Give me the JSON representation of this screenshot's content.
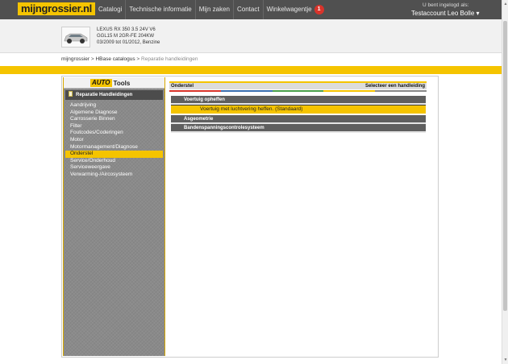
{
  "topbar": {
    "logo": "mijngrossier.nl",
    "nav": [
      {
        "label": "Catalogi"
      },
      {
        "label": "Technische informatie"
      },
      {
        "label": "Mijn zaken"
      },
      {
        "label": "Contact"
      },
      {
        "label": "Winkelwagentje"
      }
    ],
    "cart_count": "1",
    "user_label": "U bent ingelogd als:",
    "user_name": "Testaccount Leo Bolle  ▾"
  },
  "vehicle": {
    "line1": "LEXUS RX 350 3.5 24V V6",
    "line2": "GGL15 M 2GR-FE 204KW",
    "line3": "03/2009 tot 01/2012, Benzine"
  },
  "breadcrumb": {
    "items": [
      "mijngrossier",
      "HBase catalogus"
    ],
    "sep": " > ",
    "current": "Reparatie handleidingen"
  },
  "sidebar": {
    "logo_auto": "AUTO",
    "logo_tools": "Tools",
    "section": "Reparatie Handleidingen",
    "items": [
      {
        "label": "Aandrijving"
      },
      {
        "label": "Algemene Diagnose"
      },
      {
        "label": "Carrosserie Binnen"
      },
      {
        "label": "Filter"
      },
      {
        "label": "Foutcodes/Coderingen"
      },
      {
        "label": "Motor"
      },
      {
        "label": "Motormanagement/Diagnose"
      },
      {
        "label": "Onderstel"
      },
      {
        "label": "Service/Onderhoud"
      },
      {
        "label": "Serviceweergave"
      },
      {
        "label": "Verwarming-/Aircosysteem"
      }
    ],
    "active_index": 7
  },
  "content": {
    "title": "Onderstel",
    "select_label": "Selecteer een handleiding",
    "colorbar": [
      "#d9342b",
      "#3a6fb0",
      "#49a04a",
      "#f5c400",
      "#888888"
    ],
    "groups": [
      {
        "label": "Voertuig opheffen",
        "sub": "Voertuig met luchtvering heffen. (Standaard)"
      },
      {
        "label": "Asgeometrie",
        "sub": ""
      },
      {
        "label": "Bandenspanningscontrolesysteem",
        "sub": ""
      }
    ]
  },
  "colors": {
    "accent": "#f5c400",
    "nav_bg": "#505050",
    "badge": "#d9342b"
  }
}
